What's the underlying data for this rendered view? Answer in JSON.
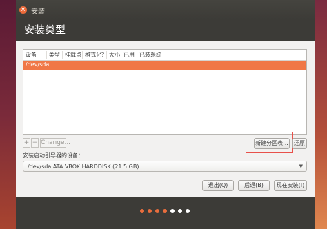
{
  "window": {
    "title": "安装",
    "close_glyph": "×"
  },
  "page": {
    "title": "安装类型"
  },
  "table": {
    "columns": [
      "设备",
      "类型",
      "挂载点",
      "格式化？",
      "大小",
      "已用",
      "已装系统"
    ],
    "rows": [
      {
        "device": "/dev/sda"
      }
    ]
  },
  "tools": {
    "add": "+",
    "remove": "−",
    "change": "Change..."
  },
  "buttons": {
    "new_partition_table": "新建分区表...",
    "revert": "还原",
    "quit": "退出(Q)",
    "back": "后退(B)",
    "install_now": "现在安装(I)"
  },
  "boot_loader": {
    "label": "安装启动引导器的设备：",
    "selected": "/dev/sda  ATA VBOX HARDDISK (21.5 GB)"
  },
  "progress": {
    "dots_total": 7,
    "dots_done": 4,
    "active_color": "#e96d3d",
    "inactive_color": "#ffffff"
  },
  "colors": {
    "accent": "#f07746",
    "highlight": "#e8504a"
  }
}
